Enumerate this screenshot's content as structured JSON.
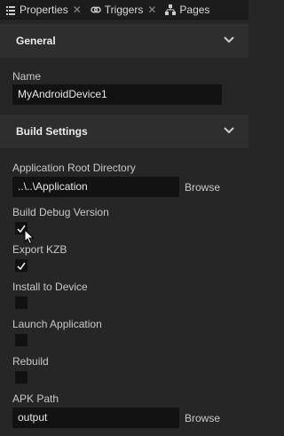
{
  "tabs": [
    {
      "label": "Properties",
      "icon": "properties-list-icon"
    },
    {
      "label": "Triggers",
      "icon": "link-icon"
    },
    {
      "label": "Pages",
      "icon": "hierarchy-icon"
    }
  ],
  "sections": {
    "general": "General",
    "build": "Build Settings"
  },
  "fields": {
    "name_label": "Name",
    "name_value": "MyAndroidDevice1",
    "app_root_label": "Application Root Directory",
    "app_root_value": "..\\..\\Application",
    "browse_label": "Browse",
    "debug_label": "Build Debug Version",
    "debug_checked": true,
    "export_label": "Export KZB",
    "export_checked": true,
    "install_label": "Install to Device",
    "install_checked": false,
    "launch_label": "Launch Application",
    "launch_checked": false,
    "rebuild_label": "Rebuild",
    "rebuild_checked": false,
    "apk_label": "APK Path",
    "apk_value": "output"
  }
}
